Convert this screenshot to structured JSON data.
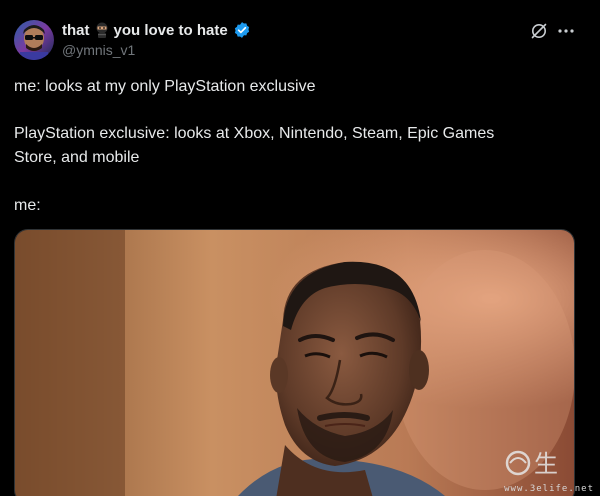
{
  "author": {
    "name_part1": "that",
    "name_part2": "you love to hate",
    "handle": "@ymnis_v1",
    "verified": true
  },
  "post": {
    "line1": "me: looks at my only PlayStation exclusive",
    "line2": "PlayStation exclusive: looks at Xbox, Nintendo, Steam, Epic Games",
    "line3": "Store, and mobile",
    "line4": "me:"
  },
  "icons": {
    "grok": "grok-icon",
    "more": "more-options-icon",
    "verified": "verified-badge-icon",
    "emoji": "ninja-emoji-icon"
  },
  "watermark": {
    "url": "www.3elife.net",
    "glyph": "生"
  },
  "colors": {
    "background": "#000000",
    "text": "#e7e9ea",
    "secondary": "#71767b",
    "verified_blue": "#1d9bf0"
  }
}
